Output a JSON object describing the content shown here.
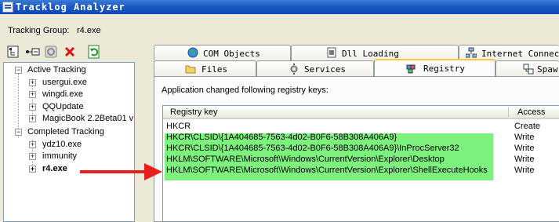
{
  "window": {
    "title": "Tracklog Analyzer"
  },
  "tracking_group": {
    "label": "Tracking Group:",
    "value": "r4.exe"
  },
  "toolbar": {
    "icons": [
      "tree-view-icon",
      "expand-icon",
      "record-icon",
      "delete-icon",
      "refresh-icon"
    ]
  },
  "tree": {
    "active_label": "Active Tracking",
    "active_items": [
      "usergui.exe",
      "wingdi.exe",
      "QQUpdate",
      "MagicBook 2.2Beta01 v"
    ],
    "completed_label": "Completed Tracking",
    "completed_items": [
      "ydz10.exe",
      "immunity",
      "r4.exe"
    ],
    "selected": "r4.exe"
  },
  "tabs": {
    "row1": [
      "COM Objects",
      "Dll Loading",
      "Internet Connecti"
    ],
    "row2": [
      "Files",
      "Services",
      "Registry",
      "Spaw"
    ],
    "active": "Registry"
  },
  "registry": {
    "description": "Application changed following registry keys:",
    "columns": [
      "Registry key",
      "Access"
    ],
    "rows": [
      {
        "key": "HKCR",
        "access": "Create"
      },
      {
        "key": "HKCR\\CLSID\\{1A404685-7563-4d02-B0F6-58B308A406A9}",
        "access": "Write"
      },
      {
        "key": "HKCR\\CLSID\\{1A404685-7563-4d02-B0F6-58B308A406A9}\\InProcServer32",
        "access": "Write"
      },
      {
        "key": "HKLM\\SOFTWARE\\Microsoft\\Windows\\CurrentVersion\\Explorer\\Desktop",
        "access": "Write"
      },
      {
        "key": "HKLM\\SOFTWARE\\Microsoft\\Windows\\CurrentVersion\\Explorer\\ShellExecuteHooks",
        "access": "Write"
      }
    ]
  },
  "colors": {
    "highlight": "#7df07d",
    "arrow": "#e8201c",
    "title_bar": "#0a46b8"
  }
}
